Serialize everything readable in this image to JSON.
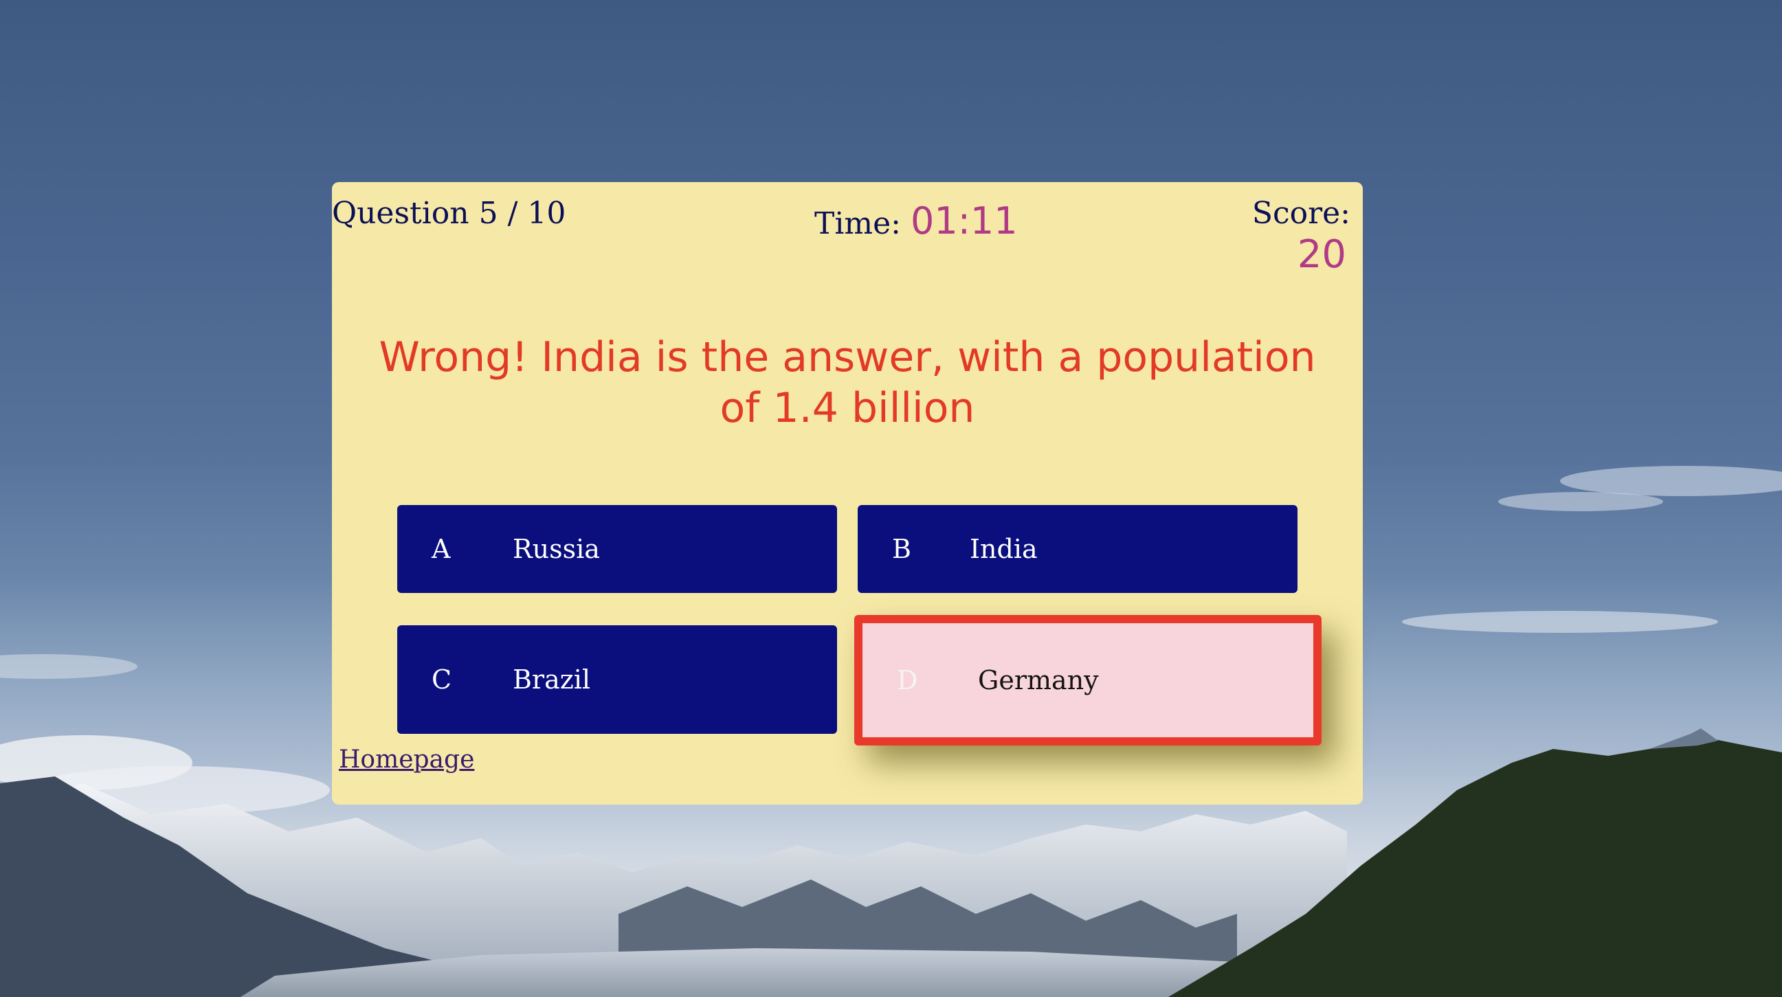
{
  "header": {
    "question_counter": "Question 5 / 10",
    "time_label": "Time: ",
    "time_value": "01:11",
    "score_label": "Score:",
    "score_value": "20"
  },
  "feedback": "Wrong! India is the answer, with a population of 1.4 billion",
  "answers": [
    {
      "letter": "A",
      "text": "Russia",
      "state": "default"
    },
    {
      "letter": "B",
      "text": "India",
      "state": "default"
    },
    {
      "letter": "C",
      "text": "Brazil",
      "state": "default"
    },
    {
      "letter": "D",
      "text": "Germany",
      "state": "selected-wrong"
    }
  ],
  "links": {
    "homepage": "Homepage"
  },
  "colors": {
    "card_bg": "#f6e9a7",
    "answer_bg": "#0a0f7d",
    "wrong_border": "#e8392b",
    "wrong_bg": "#f8d5dc",
    "accent_magenta": "#b03a86",
    "feedback_red": "#e23a27",
    "text_navy": "#0b0f57"
  }
}
